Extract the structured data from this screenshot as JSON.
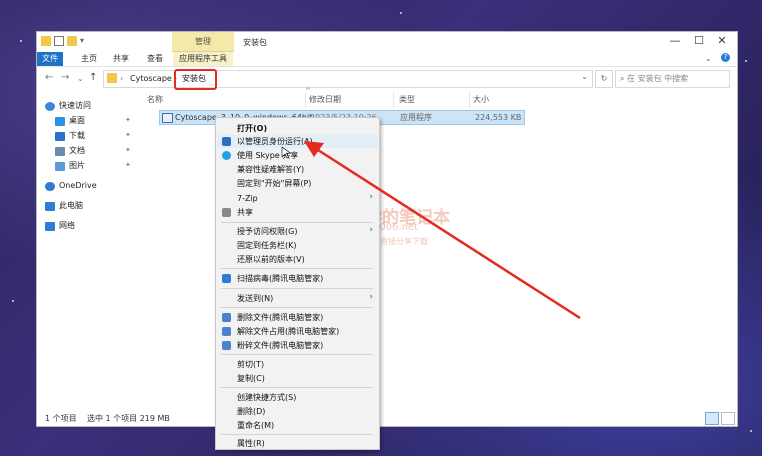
{
  "window": {
    "title": "安装包",
    "contextual_tab": "管理",
    "controls": [
      "—",
      "☐",
      "✕"
    ]
  },
  "ribbon": {
    "tabs": [
      "文件",
      "主页",
      "共享",
      "查看",
      "应用程序工具"
    ]
  },
  "address": {
    "breadcrumbs": [
      "Cytoscape",
      "安装包"
    ],
    "search_placeholder": "在 安装包 中搜索"
  },
  "nav_pane": {
    "items": [
      {
        "label": "快速访问",
        "icon": "star-icon",
        "color": "#3a87d8"
      },
      {
        "label": "桌面",
        "icon": "desktop-icon",
        "color": "#2d8fe6",
        "pinned": true
      },
      {
        "label": "下载",
        "icon": "download-icon",
        "color": "#2d6fd1",
        "pinned": true
      },
      {
        "label": "文档",
        "icon": "document-icon",
        "color": "#6b8bb0",
        "pinned": true
      },
      {
        "label": "图片",
        "icon": "picture-icon",
        "color": "#5f9ad6",
        "pinned": true
      },
      {
        "label": "OneDrive",
        "icon": "cloud-icon",
        "color": "#2f7dd3"
      },
      {
        "label": "此电脑",
        "icon": "computer-icon",
        "color": "#2f7dd3"
      },
      {
        "label": "网络",
        "icon": "network-icon",
        "color": "#2f7dd3"
      }
    ],
    "pin_glyph": "📌"
  },
  "file_list": {
    "columns": [
      "名称",
      "修改日期",
      "类型",
      "大小"
    ],
    "sort_indicator": "^",
    "rows": [
      {
        "name": "Cytoscape_3_10_0_windows_64bit",
        "date": "2023/5/23 10:26",
        "type": "应用程序",
        "size": "224,553 KB"
      }
    ]
  },
  "status_bar": {
    "count": "1 个项目",
    "selected": "选中 1 个项目  219 MB"
  },
  "context_menu": {
    "items": [
      {
        "label": "打开(O)",
        "bold": true
      },
      {
        "label": "以管理员身份运行(A)",
        "icon": "shield-icon",
        "icon_color": "#2f6fbf"
      },
      {
        "label": "使用 Skype 共享",
        "icon": "skype-icon",
        "icon_color": "#1fa1e6"
      },
      {
        "label": "兼容性疑难解答(Y)"
      },
      {
        "label": "固定到\"开始\"屏幕(P)"
      },
      {
        "label": "7-Zip",
        "submenu": true
      },
      {
        "label": "共享",
        "icon": "share-icon",
        "icon_color": "#555555"
      },
      {
        "label": "授予访问权限(G)",
        "submenu": true
      },
      {
        "label": "固定到任务栏(K)"
      },
      {
        "label": "还原以前的版本(V)"
      },
      {
        "label": "扫描病毒(腾讯电脑管家)",
        "icon": "scan-icon",
        "icon_color": "#2f7dd3"
      },
      {
        "label": "发送到(N)",
        "submenu": true
      },
      {
        "label": "删除文件(腾讯电脑管家)",
        "icon": "delete-icon",
        "icon_color": "#4a83c9"
      },
      {
        "label": "解除文件占用(腾讯电脑管家)",
        "icon": "unlock-icon",
        "icon_color": "#4a83c9"
      },
      {
        "label": "粉碎文件(腾讯电脑管家)",
        "icon": "shred-icon",
        "icon_color": "#4a83c9"
      },
      {
        "label": "剪切(T)"
      },
      {
        "label": "复制(C)"
      },
      {
        "label": "创建快捷方式(S)"
      },
      {
        "label": "删除(D)"
      },
      {
        "label": "重命名(M)"
      },
      {
        "label": "属性(R)"
      }
    ]
  },
  "watermark": {
    "title": "丁同学的笔记本",
    "url": "www.ds006.net",
    "tagline": "软件、资源、资料网盘直接分享下载"
  },
  "colors": {
    "highlight_box": "#e62a1f",
    "arrow": "#e62a1f",
    "file_tab": "#1e73c9",
    "selection": "#cce4f7"
  }
}
